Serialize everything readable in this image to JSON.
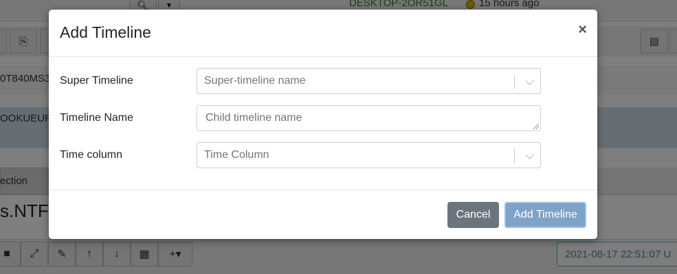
{
  "background": {
    "hostname": "DESKTOP-2OR51GL",
    "last_seen": "15 hours ago",
    "row1_text": "0T840MS3",
    "row2_text": "OOKUEUP",
    "tab_text": "ection",
    "big_text": "s.NTFS",
    "datetime": "2021-08-17 22:51:07 U"
  },
  "modal": {
    "title": "Add Timeline",
    "close_symbol": "×",
    "fields": {
      "super_timeline": {
        "label": "Super Timeline",
        "placeholder": "Super-timeline name"
      },
      "timeline_name": {
        "label": "Timeline Name",
        "placeholder": "Child timeline name"
      },
      "time_column": {
        "label": "Time column",
        "placeholder": "Time Column"
      }
    },
    "buttons": {
      "cancel": "Cancel",
      "add": "Add Timeline"
    }
  },
  "colors": {
    "cancel_bg": "#6c757d",
    "add_bg": "#7fa3c7",
    "backdrop": "rgba(0,0,0,0.5)"
  }
}
